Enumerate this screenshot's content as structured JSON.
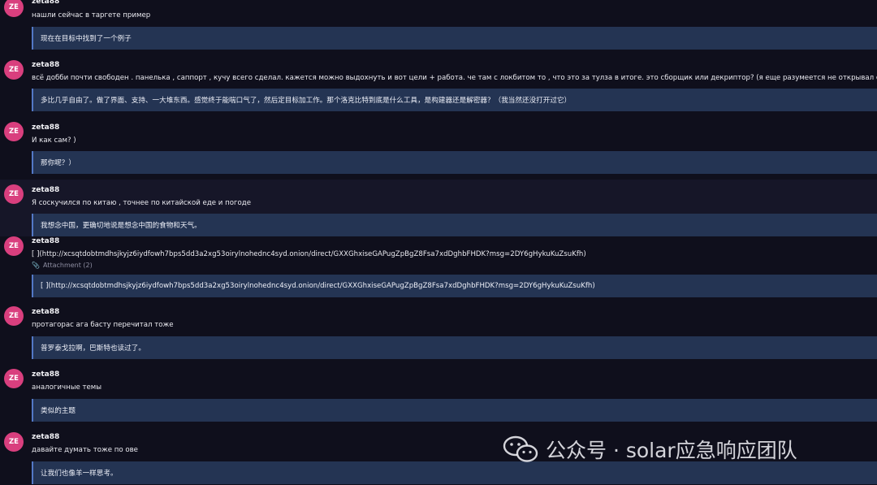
{
  "messages": [
    {
      "avatar": "ZE",
      "user": "zeta88",
      "text": "нашли сейчас в таргете пример",
      "translation": "现在在目标中找到了一个例子"
    },
    {
      "avatar": "ZE",
      "user": "zeta88",
      "text": "всё добби почти свободен . панелька , саппорт , кучу всего сделал. кажется можно выдохнуть и вот цели + работа. че там с локбитом то , что это за тулза в итоге. это сборщик или декриптор? (я еще разумеется не открывал его даже)",
      "translation": "多比几乎自由了。做了界面、支持、一大堆东西。感觉终于能喘口气了，然后定目标加工作。那个洛克比特到底是什么工具，是构建器还是解密器？（我当然还没打开过它）"
    },
    {
      "avatar": "ZE",
      "user": "zeta88",
      "text": "И как сам? )",
      "translation": "那你呢？）"
    },
    {
      "avatar": "ZE",
      "user": "zeta88",
      "text": "Я соскучился по китаю , точнее по китайской еде и погоде",
      "translation": "我想念中国，更确切地说是想念中国的食物和天气。"
    },
    {
      "avatar": "ZE",
      "user": "zeta88",
      "text": "[ ](http://xcsqtdobtmdhsjkyjz6iydfowh7bps5dd3a2xg53oirylnohednc4syd.onion/direct/GXXGhxiseGAPugZpBgZ8Fsa7xdDghbFHDK?msg=2DY6gHykuKuZsuKfh)",
      "attachment": "Attachment (2)",
      "translation": "[ ](http://xcsqtdobtmdhsjkyjz6iydfowh7bps5dd3a2xg53oirylnohednc4syd.onion/direct/GXXGhxiseGAPugZpBgZ8Fsa7xdDghbFHDK?msg=2DY6gHykuKuZsuKfh)"
    },
    {
      "avatar": "ZE",
      "user": "zeta88",
      "text": "протагорас ага басту перечитал тоже",
      "translation": "普罗泰戈拉啊，巴斯特也读过了。"
    },
    {
      "avatar": "ZE",
      "user": "zeta88",
      "text": "аналогичные темы",
      "translation": "类似的主题"
    },
    {
      "avatar": "ZE",
      "user": "zeta88",
      "text": "давайте думать тоже по ове",
      "translation": "让我们也像羊一样思考。"
    }
  ],
  "watermark": {
    "text": "公众号 · solar应急响应团队",
    "icon": "wechat-icon"
  }
}
